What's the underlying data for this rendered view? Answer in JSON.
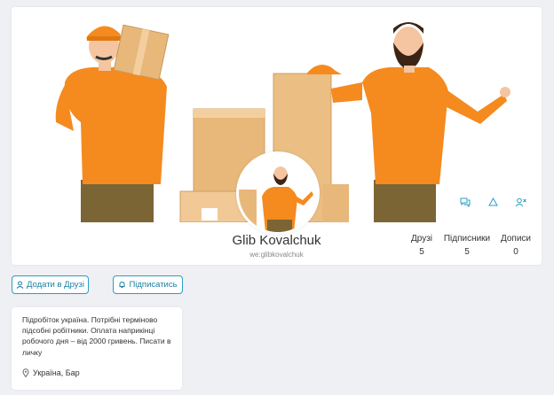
{
  "profile": {
    "name": "Glib Kovalchuk",
    "handle": "we:glibkovalchuk",
    "stats": [
      {
        "label": "Друзі",
        "value": "5"
      },
      {
        "label": "Підписники",
        "value": "5"
      },
      {
        "label": "Дописи",
        "value": "0"
      }
    ],
    "icons": [
      "chat-icon",
      "warning-icon",
      "remove-friend-icon"
    ]
  },
  "actions": {
    "add_friend": "Додати в Друзі",
    "subscribe": "Підписатись"
  },
  "about": {
    "text": "Підробіток україна. Потрібні терміново підсобні робітники. Оплата наприкінці робочого дня – від 2000 гривень. Писати в личку",
    "location": "Україна, Бар"
  },
  "colors": {
    "accent": "#2a9ec4",
    "shirt": "#f58a1f",
    "box": "#e8b77a"
  }
}
